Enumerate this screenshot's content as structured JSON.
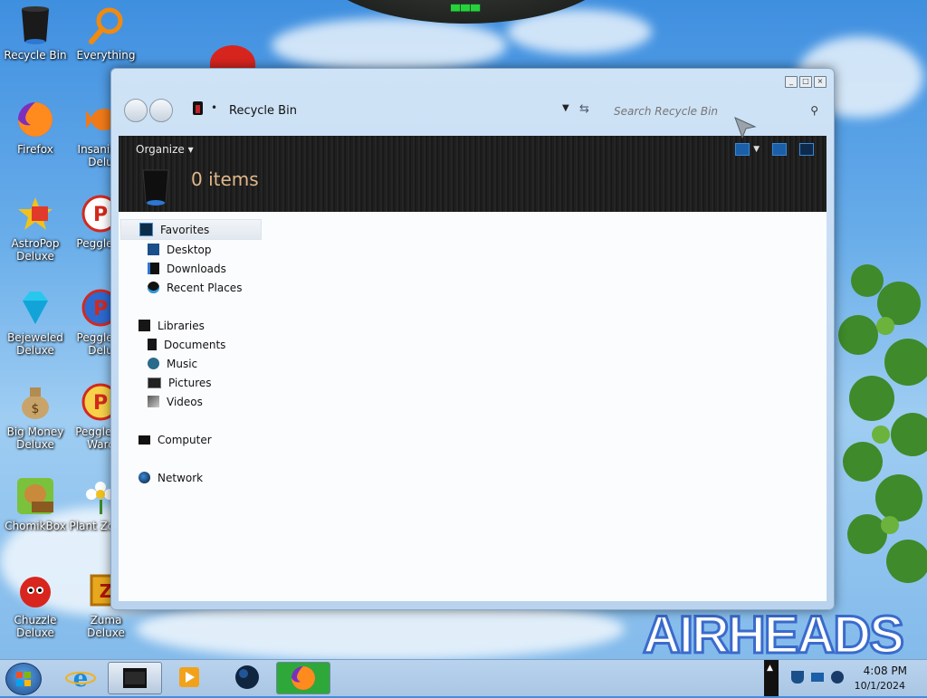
{
  "desktop": {
    "icons": [
      {
        "label": "Recycle Bin",
        "icon": "recycle-bin-icon"
      },
      {
        "label": "Everything",
        "icon": "magnifier-icon"
      },
      {
        "label": "Firefox",
        "icon": "firefox-icon"
      },
      {
        "label": "Insaniqu Delu",
        "icon": "goldfish-icon"
      },
      {
        "label": "AstroPop Deluxe",
        "icon": "astropop-icon"
      },
      {
        "label": "Peggle D",
        "icon": "peggle-icon"
      },
      {
        "label": "Bejeweled Deluxe",
        "icon": "diamond-icon"
      },
      {
        "label": "Peggle N Delu",
        "icon": "peggle-icon"
      },
      {
        "label": "Big Money Deluxe",
        "icon": "money-bag-icon"
      },
      {
        "label": "Peggle of Warc",
        "icon": "peggle-icon"
      },
      {
        "label": "ChomikBox",
        "icon": "hamster-box-icon"
      },
      {
        "label": "Plant Zomb",
        "icon": "flower-icon"
      },
      {
        "label": "Chuzzle Deluxe",
        "icon": "chuzzle-icon"
      },
      {
        "label": "Zuma Deluxe",
        "icon": "zuma-icon"
      }
    ],
    "wallpaper_text": "AIRHEADS"
  },
  "window": {
    "address": {
      "location": "Recycle Bin",
      "separator": "•"
    },
    "search": {
      "placeholder": "Search Recycle Bin"
    },
    "toolbar": {
      "organize_label": "Organize"
    },
    "status": {
      "item_count": "0 items"
    },
    "nav": {
      "favorites": {
        "label": "Favorites",
        "items": [
          "Desktop",
          "Downloads",
          "Recent Places"
        ]
      },
      "libraries": {
        "label": "Libraries",
        "items": [
          "Documents",
          "Music",
          "Pictures",
          "Videos"
        ]
      },
      "computer": {
        "label": "Computer"
      },
      "network": {
        "label": "Network"
      }
    }
  },
  "taskbar": {
    "clock": {
      "time": "4:08 PM",
      "date": "10/1/2024"
    }
  },
  "colors": {
    "accent": "#1a5fa8",
    "items_text": "#e0b78a",
    "toolbar_bg": "#1e1e1e"
  }
}
